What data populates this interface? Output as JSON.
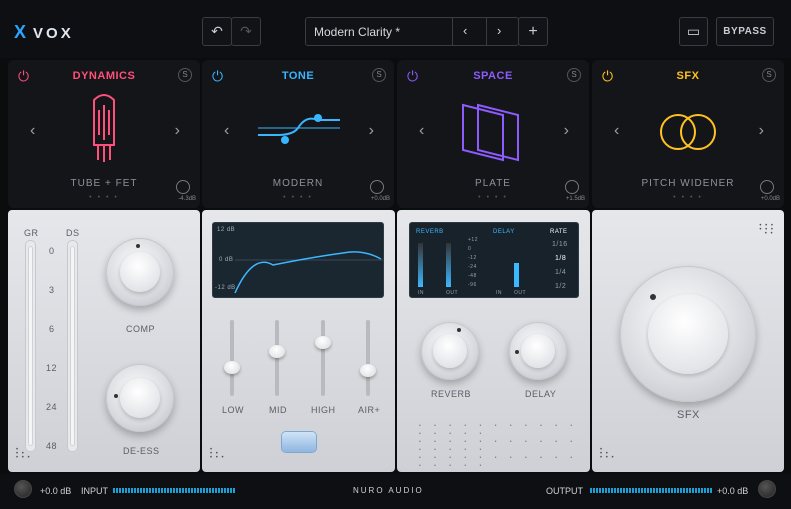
{
  "brand": {
    "logo_mark": "X",
    "name": "VOX"
  },
  "toolbar": {
    "undo_icon": "↶",
    "redo_icon": "↷",
    "preset_name": "Modern Clarity *",
    "prev": "‹",
    "next": "›",
    "add": "+",
    "bypass": "BYPASS",
    "feedback_icon": "▭"
  },
  "modules": [
    {
      "title": "DYNAMICS",
      "sub": "TUBE + FET",
      "gain": "-4.3dB",
      "color": "#ff4f7b"
    },
    {
      "title": "TONE",
      "sub": "MODERN",
      "gain": "+0.0dB",
      "color": "#38b6ff"
    },
    {
      "title": "SPACE",
      "sub": "PLATE",
      "gain": "+1.5dB",
      "color": "#8d5cff"
    },
    {
      "title": "SFX",
      "sub": "PITCH WIDENER",
      "gain": "+0.0dB",
      "color": "#ffc21f"
    }
  ],
  "nav": {
    "left": "‹",
    "right": "›",
    "power": "⏻",
    "solo": "S",
    "dots": "• • • •"
  },
  "dynamics": {
    "gr": "GR",
    "ds": "DS",
    "scale": [
      "0",
      "3",
      "6",
      "12",
      "24",
      "48"
    ],
    "comp": "COMP",
    "deess": "DE-ESS"
  },
  "tone": {
    "db_top": "12 dB",
    "db_mid": "0 dB",
    "db_bot": "-12 dB",
    "low": "LOW",
    "mid": "MID",
    "high": "HIGH",
    "air": "AIR+",
    "sliders": {
      "low": 0.35,
      "mid": 0.6,
      "high": 0.75,
      "air": 0.3
    }
  },
  "space": {
    "reverb": "REVERB",
    "delay": "DELAY",
    "rate": "RATE",
    "rates": [
      "1/16",
      "1/8",
      "1/4",
      "1/2"
    ],
    "in": "IN",
    "out": "OUT",
    "scale": [
      "+12",
      "0",
      "-12",
      "-24",
      "-48",
      "-96"
    ],
    "knob_reverb": "REVERB",
    "knob_delay": "DELAY"
  },
  "sfx": {
    "label": "SFX"
  },
  "footer": {
    "input_db": "+0.0 dB",
    "input": "INPUT",
    "brand": "NURO AUDIO",
    "output": "OUTPUT",
    "output_db": "+0.0 dB"
  }
}
